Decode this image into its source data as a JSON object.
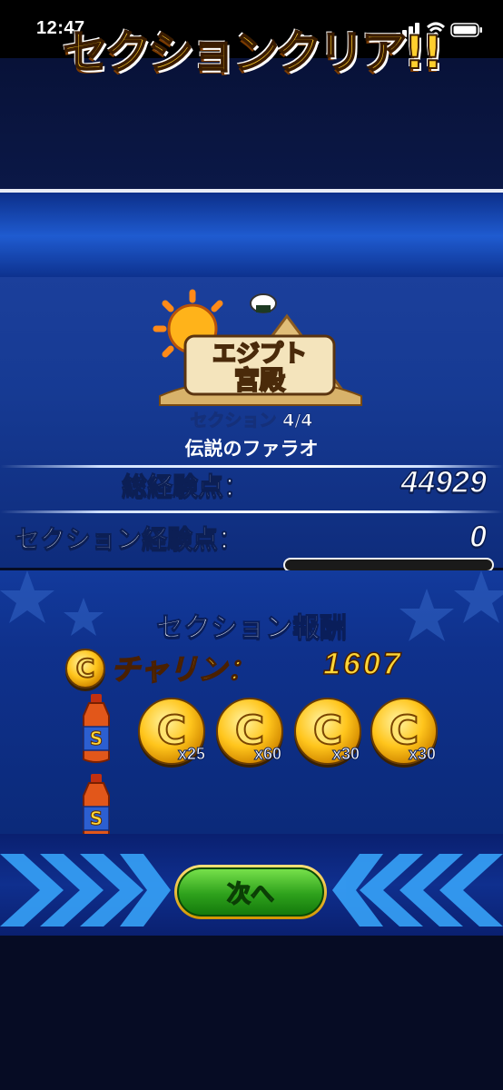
{
  "status_bar": {
    "time": "12:47"
  },
  "banner": {
    "title": "セクションクリア!!"
  },
  "logo": {
    "line1": "エジプト",
    "line2": "宮殿"
  },
  "section": {
    "number": "セクション 4/4",
    "name": "伝説のファラオ"
  },
  "stats": {
    "total_exp_label": "総経験点：",
    "total_exp_value": "44929",
    "section_exp_label": "セクション経験点：",
    "section_exp_value": "0",
    "section_exp_progress": 0
  },
  "rewards": {
    "title": "セクション報酬",
    "charin_label": "チャリン：",
    "charin_value": "1607",
    "coin_glyph": "C",
    "item_glyph": "S",
    "rows": [
      {
        "item": "bottle-icon",
        "coins": [
          "x25",
          "x60",
          "x30",
          "x30"
        ]
      },
      {
        "item": "bottle-icon",
        "coins": []
      }
    ]
  },
  "next_button": {
    "label": "次へ"
  },
  "colors": {
    "gold": "#ffd637",
    "panel_blue": "#163a93",
    "button_green": "#2ea11c"
  }
}
